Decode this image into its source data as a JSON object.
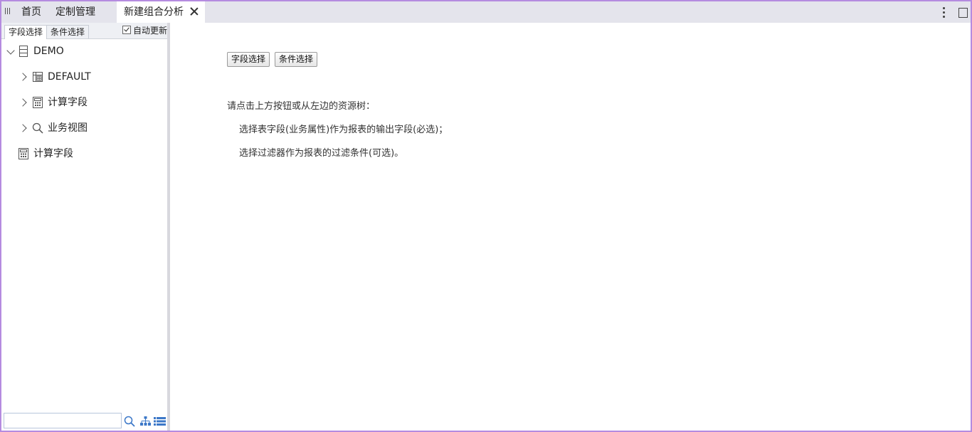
{
  "tabs": [
    {
      "label": "首页"
    },
    {
      "label": "定制管理"
    },
    {
      "label": "新建组合分析"
    }
  ],
  "left_panel": {
    "tabs": [
      {
        "label": "字段选择"
      },
      {
        "label": "条件选择"
      }
    ],
    "auto_update_label": "自动更新",
    "auto_update_checked": true,
    "tree": {
      "root": "DEMO",
      "children": [
        {
          "label": "DEFAULT"
        },
        {
          "label": "计算字段"
        },
        {
          "label": "业务视图"
        }
      ],
      "sibling": "计算字段"
    },
    "search": {
      "value": "",
      "placeholder": ""
    }
  },
  "main": {
    "buttons": {
      "field_select": "字段选择",
      "condition_select": "条件选择"
    },
    "hint_title": "请点击上方按钮或从左边的资源树：",
    "hint_line1": "选择表字段(业务属性)作为报表的输出字段(必选)；",
    "hint_line2": "选择过滤器作为报表的过滤条件(可选)。"
  },
  "icons": [
    "grip-icon",
    "close-icon",
    "more-vertical-icon",
    "maximize-icon",
    "chevron-down-icon",
    "chevron-right-icon",
    "database-icon",
    "table-grid-icon",
    "calculator-icon",
    "search-icon",
    "hierarchy-icon",
    "list-icon"
  ],
  "colors": {
    "window_border": "#b58be0",
    "tabbar_bg": "#e4e4ec",
    "icon_blue": "#3c78c8"
  }
}
